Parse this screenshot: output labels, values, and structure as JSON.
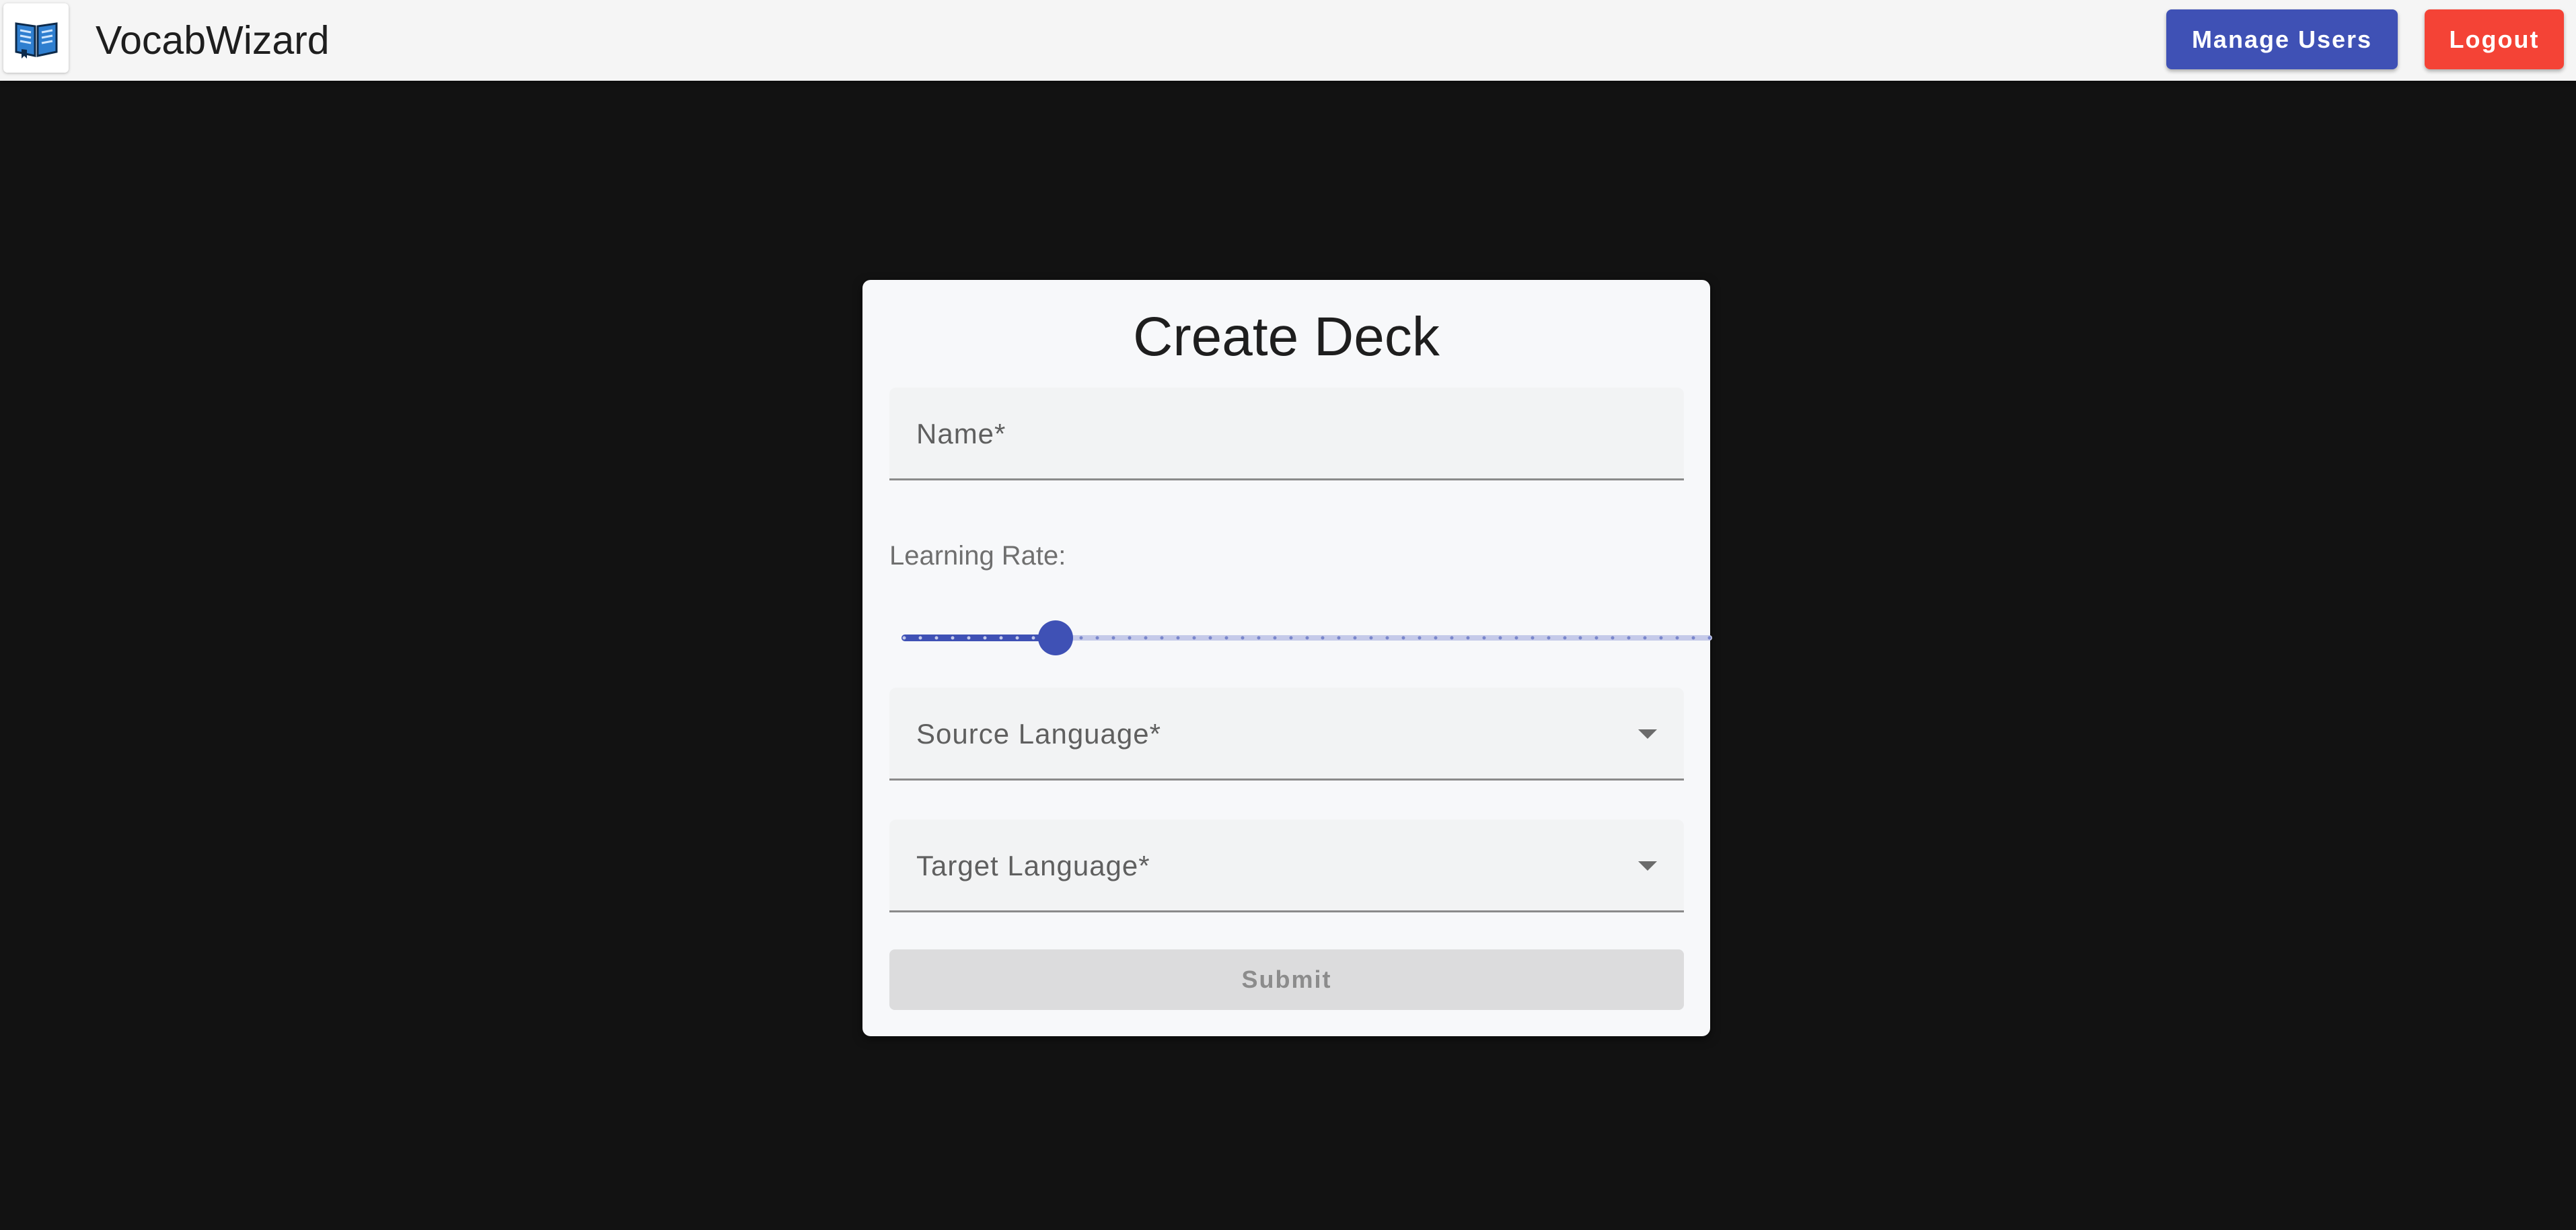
{
  "appbar": {
    "title": "VocabWizard",
    "logo_icon": "open-book-icon",
    "manage_users_label": "Manage Users",
    "logout_label": "Logout"
  },
  "colors": {
    "primary": "#3f51b5",
    "danger": "#f44336",
    "background": "#121212",
    "card": "#f7f8fa"
  },
  "form": {
    "title": "Create Deck",
    "name_label": "Name*",
    "learning_rate_label": "Learning Rate:",
    "learning_rate": {
      "value_fraction": 0.19,
      "steps": 50
    },
    "source_language_label": "Source Language*",
    "target_language_label": "Target Language*",
    "dropdown_icon": "caret-down-icon",
    "submit_label": "Submit"
  }
}
